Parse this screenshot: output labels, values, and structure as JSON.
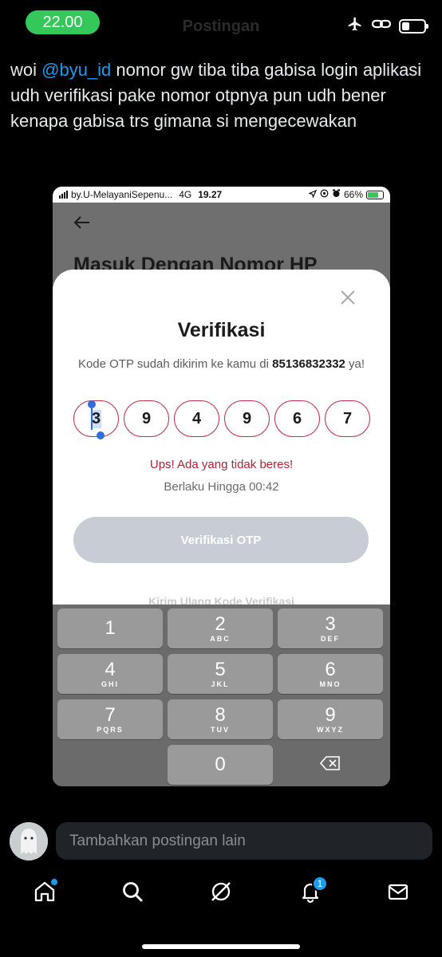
{
  "status_bar": {
    "time": "22.00",
    "title": "Postingan"
  },
  "tweet": {
    "prefix": "woi ",
    "mention": "@byu_id",
    "rest": " nomor gw tiba tiba gabisa login aplikasi udh verifikasi pake nomor otpnya pun udh bener kenapa gabisa trs gimana si mengecewakan"
  },
  "inner": {
    "carrier": "by.U-MelayaniSepenu...",
    "network": "4G",
    "time": "19.27",
    "battery": "66%",
    "bg_title": "Masuk Dengan Nomor HP",
    "sheet": {
      "title": "Verifikasi",
      "desc_prefix": "Kode OTP sudah dikirim ke kamu di ",
      "phone": "85136832332",
      "desc_suffix": " ya!",
      "otp": [
        "3",
        "9",
        "4",
        "9",
        "6",
        "7"
      ],
      "error": "Ups! Ada yang tidak beres!",
      "valid": "Berlaku Hingga 00:42",
      "button": "Verifikasi OTP",
      "resend": "Kirim Ulang Kode Verifikasi"
    },
    "keypad": {
      "row1": [
        {
          "d": "1",
          "l": ""
        },
        {
          "d": "2",
          "l": "ABC"
        },
        {
          "d": "3",
          "l": "DEF"
        }
      ],
      "row2": [
        {
          "d": "4",
          "l": "GHI"
        },
        {
          "d": "5",
          "l": "JKL"
        },
        {
          "d": "6",
          "l": "MNO"
        }
      ],
      "row3": [
        {
          "d": "7",
          "l": "PQRS"
        },
        {
          "d": "8",
          "l": "TUV"
        },
        {
          "d": "9",
          "l": "WXYZ"
        }
      ],
      "zero": "0"
    }
  },
  "reply": {
    "placeholder": "Tambahkan postingan lain"
  },
  "nav": {
    "notifications_count": "1"
  },
  "colors": {
    "accent": "#1d9bf0",
    "time_pill": "#34c759",
    "otp_border": "#c4314b"
  }
}
